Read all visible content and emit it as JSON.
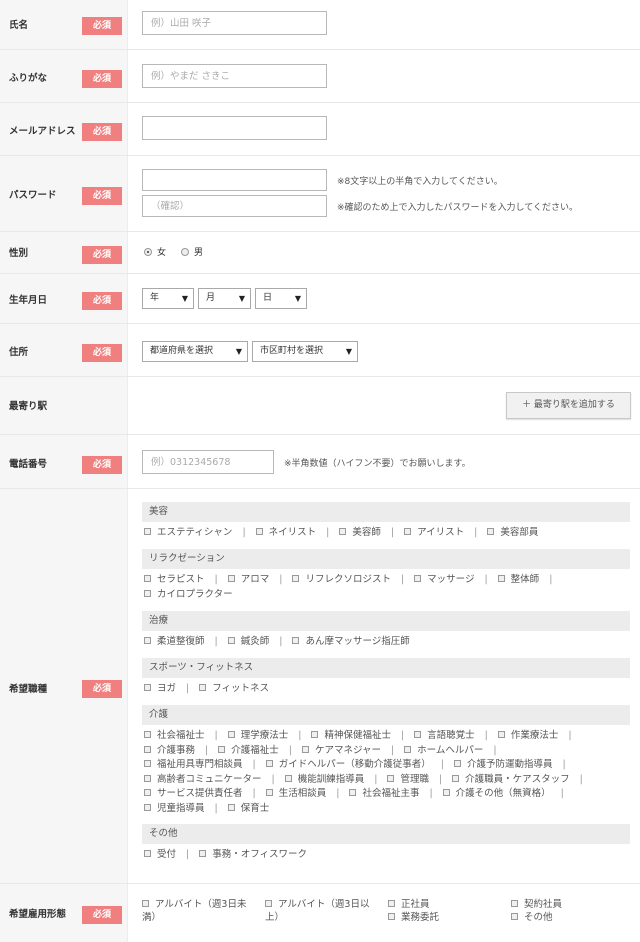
{
  "required_label": "必須",
  "name": {
    "label": "氏名",
    "placeholder": "例）山田 咲子"
  },
  "furigana": {
    "label": "ふりがな",
    "placeholder": "例）やまだ さきこ"
  },
  "email": {
    "label": "メールアドレス",
    "placeholder": ""
  },
  "password": {
    "label": "パスワード",
    "placeholder": "",
    "confirm_placeholder": "（確認）",
    "note1": "※8文字以上の半角で入力してください。",
    "note2": "※確認のため上で入力したパスワードを入力してください。"
  },
  "gender": {
    "label": "性別",
    "options": [
      "女",
      "男"
    ],
    "selected": "女"
  },
  "birthday": {
    "label": "生年月日",
    "year": "年",
    "month": "月",
    "day": "日"
  },
  "address": {
    "label": "住所",
    "prefecture": "都道府県を選択",
    "city": "市区町村を選択"
  },
  "station": {
    "label": "最寄り駅",
    "add_button": "＋ 最寄り駅を追加する"
  },
  "phone": {
    "label": "電話番号",
    "placeholder": "例）0312345678",
    "note": "※半角数値（ハイフン不要）でお願いします。"
  },
  "occupation": {
    "label": "希望職種",
    "categories": [
      {
        "name": "美容",
        "lines": [
          [
            "エステティシャン",
            "ネイリスト",
            "美容師",
            "アイリスト",
            "美容部員"
          ]
        ]
      },
      {
        "name": "リラクゼーション",
        "lines": [
          [
            "セラピスト",
            "アロマ",
            "リフレクソロジスト",
            "マッサージ",
            "整体師",
            ""
          ],
          [
            "カイロプラクター"
          ]
        ]
      },
      {
        "name": "治療",
        "lines": [
          [
            "柔道整復師",
            "鍼灸師",
            "あん摩マッサージ指圧師"
          ]
        ]
      },
      {
        "name": "スポーツ・フィットネス",
        "lines": [
          [
            "ヨガ",
            "フィットネス"
          ]
        ]
      },
      {
        "name": "介護",
        "lines": [
          [
            "社会福祉士",
            "理学療法士",
            "精神保健福祉士",
            "言語聴覚士",
            "作業療法士",
            ""
          ],
          [
            "介護事務",
            "介護福祉士",
            "ケアマネジャー",
            "ホームヘルパー",
            ""
          ],
          [
            "福祉用具専門相談員",
            "ガイドヘルパー（移動介護従事者）",
            "介護予防運動指導員",
            ""
          ],
          [
            "高齢者コミュニケーター",
            "機能訓練指導員",
            "管理職",
            "介護職員・ケアスタッフ",
            ""
          ],
          [
            "サービス提供責任者",
            "生活相談員",
            "社会福祉主事",
            "介護その他（無資格）",
            ""
          ],
          [
            "児童指導員",
            "保育士"
          ]
        ]
      },
      {
        "name": "その他",
        "lines": [
          [
            "受付",
            "事務・オフィスワーク"
          ]
        ]
      }
    ]
  },
  "employment": {
    "label": "希望雇用形態",
    "items": [
      {
        "line1": "アルバイト（週3日未",
        "line2": "満）"
      },
      {
        "line1": "アルバイト（週3日以",
        "line2": "上）"
      },
      {
        "line1": "正社員"
      },
      {
        "line1": "業務委託"
      },
      {
        "line1": "契約社員"
      },
      {
        "line1": "その他"
      }
    ]
  },
  "colors": {
    "required": "#f08080",
    "label_bg": "#f6f6f6",
    "category_bg": "#ececec"
  }
}
